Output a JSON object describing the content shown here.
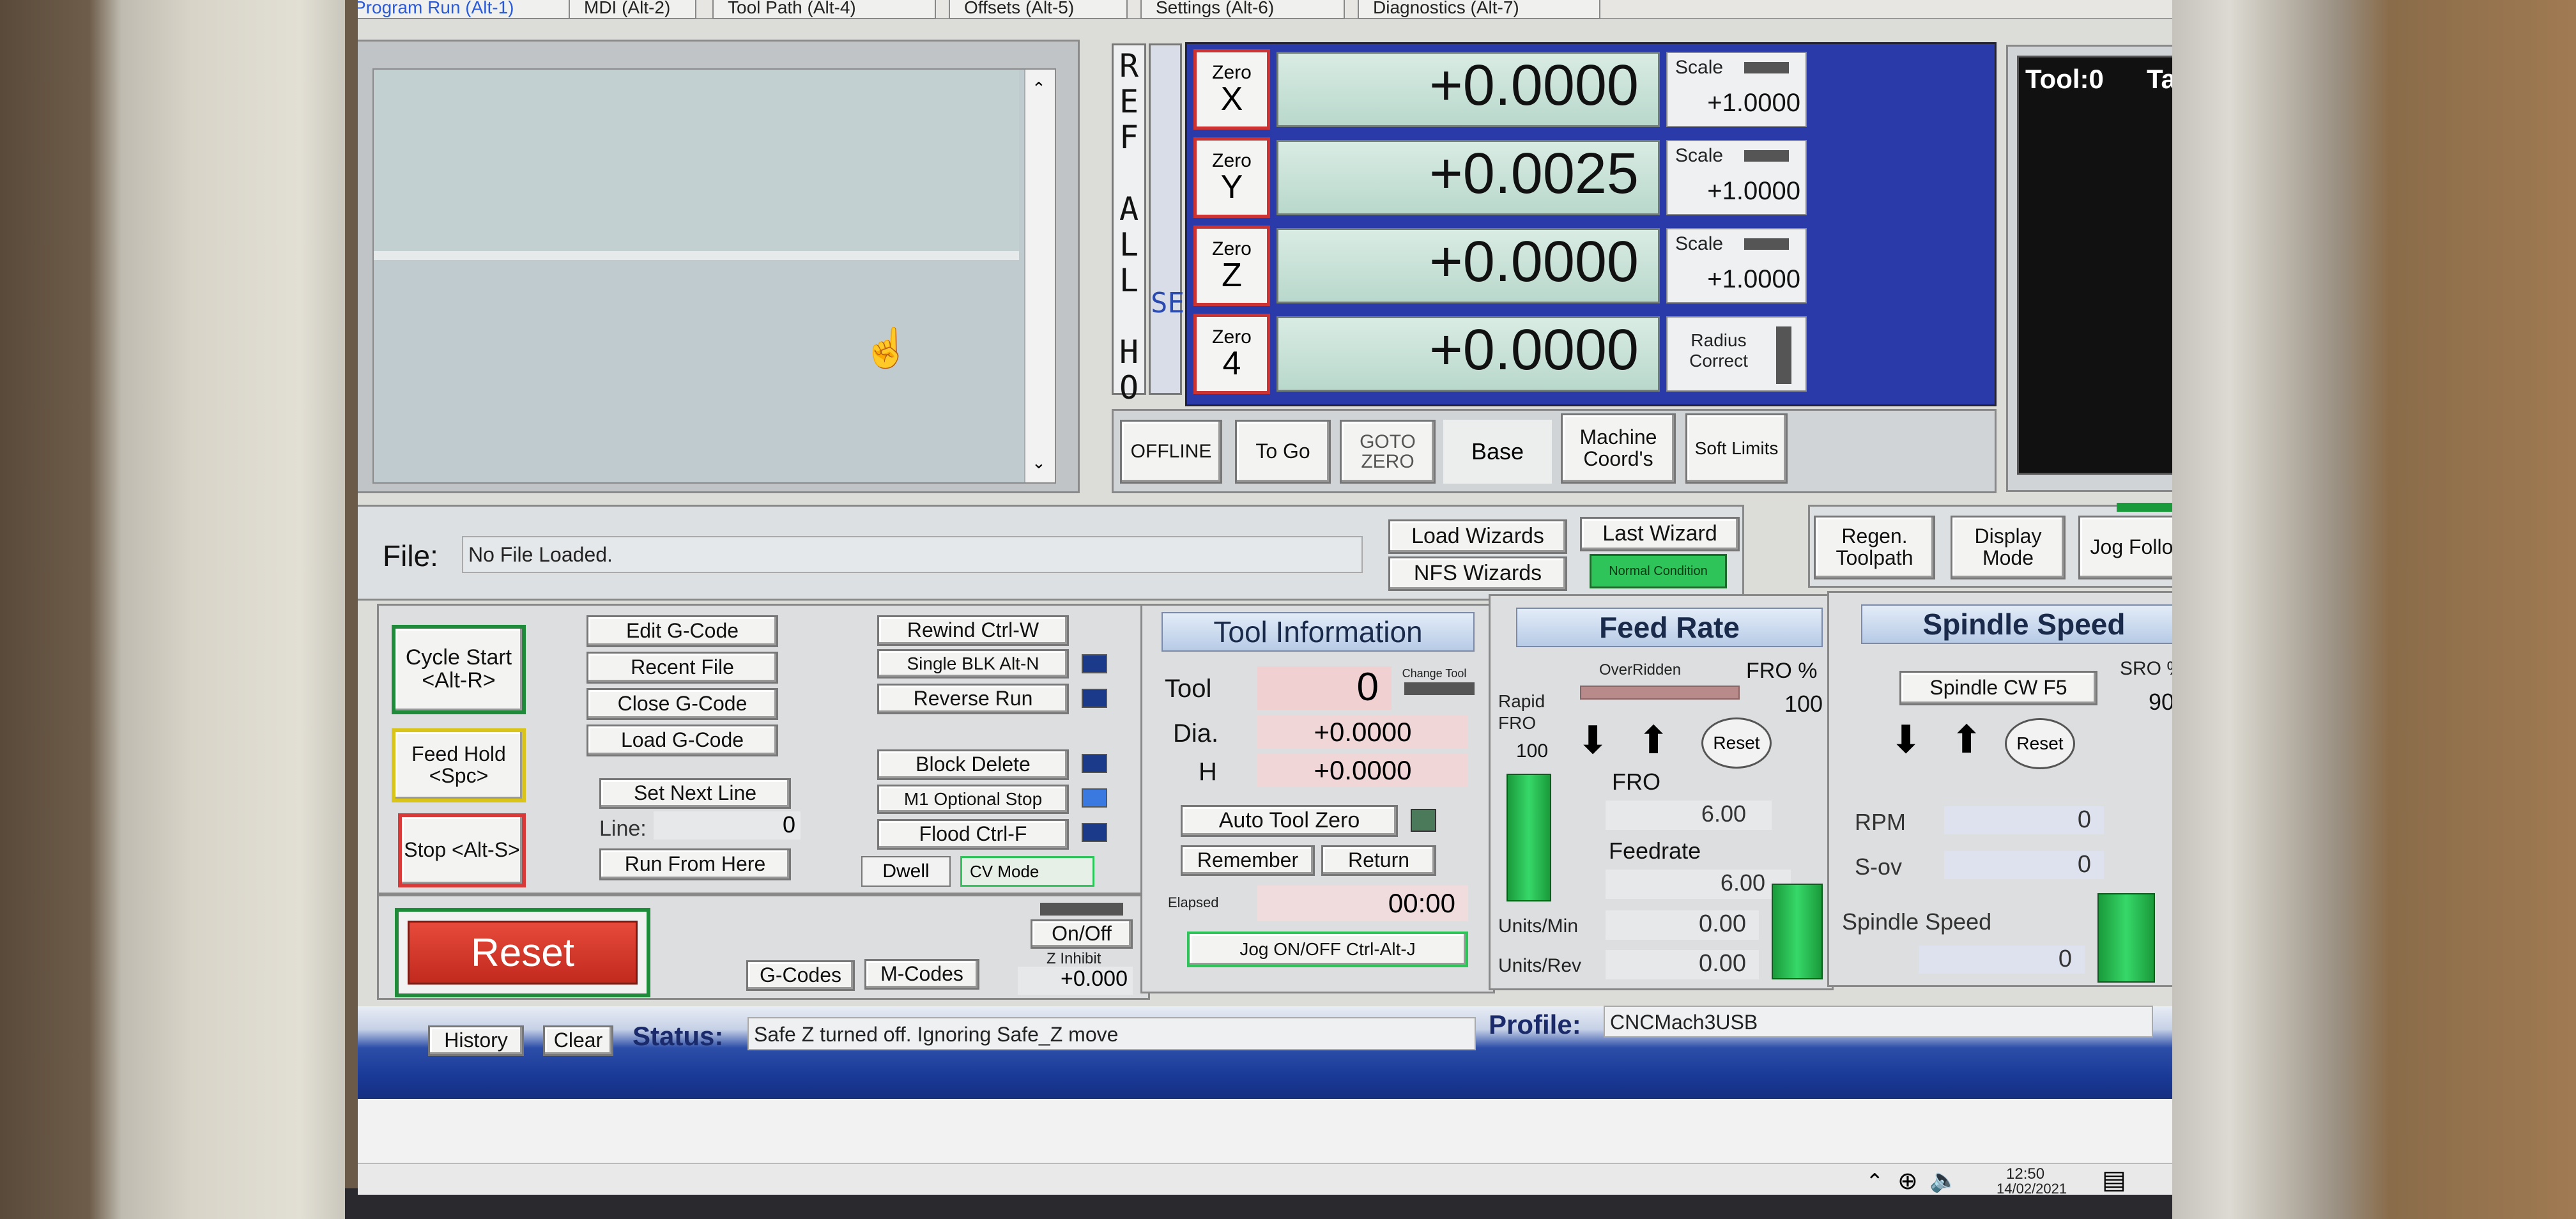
{
  "tabs": [
    "Program Run (Alt-1)",
    "MDI (Alt-2)",
    "Tool Path (Alt-4)",
    "Offsets (Alt-5)",
    "Settings (Alt-6)",
    "Diagnostics (Alt-7)"
  ],
  "ref_all_home": "REF ALL HOME",
  "set": "SET",
  "axes": [
    {
      "zero": "Zero",
      "name": "X",
      "value": "+0.0000",
      "side_label": "Scale",
      "side_value": "+1.0000"
    },
    {
      "zero": "Zero",
      "name": "Y",
      "value": "+0.0025",
      "side_label": "Scale",
      "side_value": "+1.0000"
    },
    {
      "zero": "Zero",
      "name": "Z",
      "value": "+0.0000",
      "side_label": "Scale",
      "side_value": "+1.0000"
    },
    {
      "zero": "Zero",
      "name": "4",
      "value": "+0.0000",
      "side_label": "Radius Correct",
      "side_value": ""
    }
  ],
  "dro_buttons": {
    "offline": "OFFLINE",
    "to_go": "To Go",
    "goto_zero": "GOTO ZERO",
    "base": "Base",
    "machine_coords": "Machine Coord's",
    "soft_limits": "Soft Limits"
  },
  "tool_display": {
    "tool": "Tool:0",
    "title": "Table Display"
  },
  "file": {
    "label": "File:",
    "value": "No File Loaded."
  },
  "wizards": {
    "load": "Load Wizards",
    "last": "Last Wizard",
    "nfs": "NFS Wizards",
    "normal": "Normal Condition"
  },
  "toolpath_buttons": {
    "regen": "Regen. Toolpath",
    "display_mode": "Display Mode",
    "jog_follow": "Jog Follow"
  },
  "run_controls": {
    "cycle_start": "Cycle Start <Alt-R>",
    "feed_hold": "Feed Hold <Spc>",
    "stop": "Stop <Alt-S>",
    "edit_gcode": "Edit G-Code",
    "recent_file": "Recent File",
    "close_gcode": "Close G-Code",
    "load_gcode": "Load G-Code",
    "set_next_line": "Set Next Line",
    "line_label": "Line:",
    "line_value": "0",
    "run_from_here": "Run From Here",
    "rewind": "Rewind Ctrl-W",
    "single_blk": "Single BLK Alt-N",
    "reverse_run": "Reverse Run",
    "block_delete": "Block Delete",
    "m1_optional_stop": "M1 Optional Stop",
    "flood": "Flood Ctrl-F",
    "dwell": "Dwell",
    "cv_mode": "CV Mode",
    "reset": "Reset",
    "gcodes": "G-Codes",
    "mcodes": "M-Codes",
    "on_off": "On/Off",
    "z_inhibit": "Z Inhibit",
    "z_inhibit_value": "+0.000"
  },
  "tool_info": {
    "title": "Tool Information",
    "tool_label": "Tool",
    "tool_value": "0",
    "change": "Change Tool",
    "dia_label": "Dia.",
    "dia_value": "+0.0000",
    "h_label": "H",
    "h_value": "+0.0000",
    "auto_tool_zero": "Auto Tool Zero",
    "remember": "Remember",
    "return": "Return",
    "elapsed_label": "Elapsed",
    "elapsed_value": "00:00",
    "jog": "Jog ON/OFF Ctrl-Alt-J"
  },
  "feed_rate": {
    "title": "Feed Rate",
    "overridden": "OverRidden",
    "fro_pct_label": "FRO %",
    "fro_pct_value": "100",
    "rapid_fro": "Rapid FRO",
    "rapid_value": "100",
    "reset": "Reset",
    "fro_label": "FRO",
    "fro_value": "6.00",
    "feedrate_label": "Feedrate",
    "feedrate_value": "6.00",
    "units_min_label": "Units/Min",
    "units_min_value": "0.00",
    "units_rev_label": "Units/Rev",
    "units_rev_value": "0.00"
  },
  "spindle": {
    "title": "Spindle Speed",
    "cw": "Spindle CW F5",
    "sro_label": "SRO %",
    "sro_value": "90",
    "reset": "Reset",
    "rpm_label": "RPM",
    "rpm_value": "0",
    "sov_label": "S-ov",
    "sov_value": "0",
    "speed_label": "Spindle Speed",
    "speed_value": "0"
  },
  "status_bar": {
    "history": "History",
    "clear": "Clear",
    "status_label": "Status:",
    "status_value": "Safe Z turned off. Ignoring Safe_Z move",
    "profile_label": "Profile:",
    "profile_value": "CNCMach3USB"
  },
  "taskbar": {
    "time": "12:50",
    "date": "14/02/2021"
  },
  "colors": {
    "dro_bg": "#c6e3d8",
    "zero_border": "#cc3333",
    "accent_green": "#2fc45a",
    "header_blue": "#c6d6ee"
  }
}
